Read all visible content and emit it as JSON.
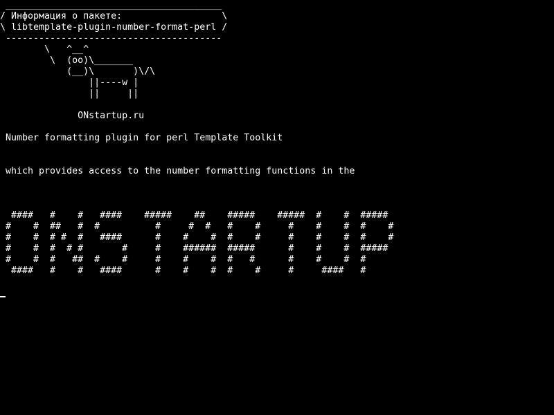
{
  "terminal": {
    "bubble": {
      "top_border": " _______________________________________",
      "line1": "/ Информация о пакете:                  \\",
      "line2": "\\ libtemplate-plugin-number-format-perl /",
      "bottom_border": " ---------------------------------------"
    },
    "cow": [
      "        \\   ^__^",
      "         \\  (oo)\\_______",
      "            (__)\\       )\\/\\",
      "                ||----w |",
      "                ||     ||"
    ],
    "signature": "              ONstartup.ru",
    "description": [
      " Number formatting plugin for perl Template Toolkit",
      " which provides access to the number formatting functions in the"
    ],
    "banner": [
      "  ####   #    #   ####    #####    ##    #####    #####  #    #  #####",
      " #    #  ##   #  #          #     #  #   #    #     #    #    #  #    #",
      " #    #  # #  #   ####      #    #    #  #    #     #    #    #  #    #",
      " #    #  #  # #       #     #    ######  #####      #    #    #  #####",
      " #    #  #   ##  #    #     #    #    #  #   #      #    #    #  #",
      "  ####   #    #   ####      #    #    #  #    #     #     ####   #"
    ]
  }
}
